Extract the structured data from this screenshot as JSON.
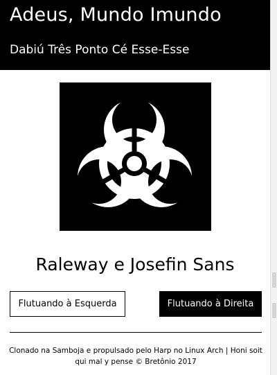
{
  "header": {
    "title": "Adeus, Mundo Imundo",
    "subtitle": "Dabiú Três Ponto Cé Esse-Esse"
  },
  "hero": {
    "icon": "biohazard-icon"
  },
  "fonts_heading": "Raleway e Josefin Sans",
  "buttons": {
    "left_label": "Flutuando à Esquerda",
    "right_label": "Flutuando à Direita"
  },
  "footer": {
    "text": "Clonado na Samboja e propulsado pelo Harp no Linux Arch | Honi soit qui mal y pense © Bretônio 2017"
  },
  "colors": {
    "header_bg": "#000000",
    "header_text": "#ffffff",
    "page_bg": "#ffffff",
    "primary_button_bg": "#000000"
  }
}
